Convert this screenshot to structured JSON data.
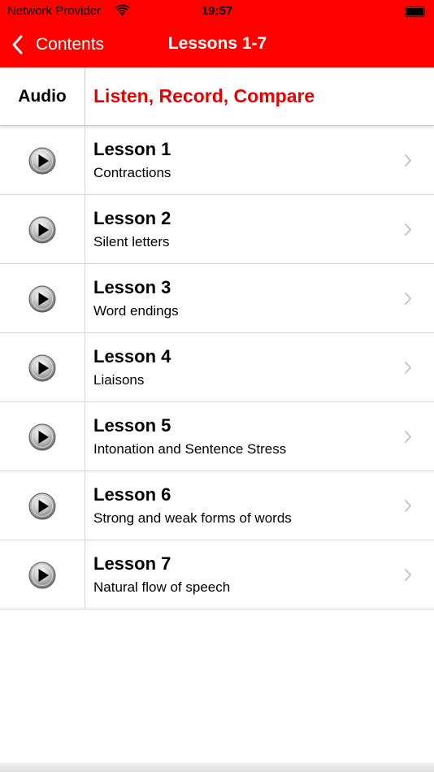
{
  "status_bar": {
    "carrier": "Network Provider",
    "time": "19:57"
  },
  "nav": {
    "back_label": "Contents",
    "title": "Lessons 1-7"
  },
  "header": {
    "audio_label": "Audio",
    "link_label": "Listen, Record, Compare",
    "link_color": "#e60000"
  },
  "lessons": [
    {
      "title": "Lesson 1",
      "subtitle": "Contractions"
    },
    {
      "title": "Lesson 2",
      "subtitle": "Silent letters"
    },
    {
      "title": "Lesson 3",
      "subtitle": "Word endings"
    },
    {
      "title": "Lesson 4",
      "subtitle": "Liaisons"
    },
    {
      "title": "Lesson 5",
      "subtitle": "Intonation and Sentence Stress"
    },
    {
      "title": "Lesson 6",
      "subtitle": "Strong and weak forms of words"
    },
    {
      "title": "Lesson 7",
      "subtitle": "Natural flow of speech"
    }
  ],
  "colors": {
    "nav_background": "#ff0000",
    "accent": "#e60000"
  },
  "icons": [
    "wifi-icon",
    "battery-icon",
    "back-chevron-icon",
    "play-icon",
    "chevron-right-icon"
  ]
}
